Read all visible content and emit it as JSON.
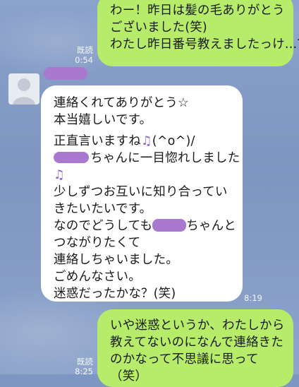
{
  "messages": {
    "m1": {
      "lines": [
        "わー！昨日は髪の毛ありがとう",
        "ございました(笑)",
        "わたし昨日番号教えましたっけ…？"
      ],
      "read_label": "既読",
      "time": "0:54"
    },
    "m2": {
      "lines": [
        "連絡くれてありがとう☆",
        "本当嬉しいです。",
        "正直言いますね",
        "(^o^)/",
        "ちゃんに一目惚れしました",
        "少しずつお互いに知り合ってい",
        "きたいたいです。",
        "なのでどうしても",
        "ちゃんと",
        "つながりたくて",
        "連絡しちゃいました。",
        "ごめんなさい。",
        "迷惑だったかな？(笑)"
      ],
      "time": "8:19"
    },
    "m3": {
      "lines": [
        "いや迷惑というか、わたしから",
        "教えてないのになんで連絡きた",
        "のかなって不思議に思って",
        "（笑）"
      ],
      "read_label": "既読",
      "time": "8:25"
    }
  },
  "colors": {
    "outgoing_bubble": "#b6ec6a",
    "incoming_bubble": "#ffffff",
    "censor_blob": "#a978cf"
  },
  "icons": {
    "note": "music-note-icon",
    "avatar": "default-avatar-icon"
  }
}
